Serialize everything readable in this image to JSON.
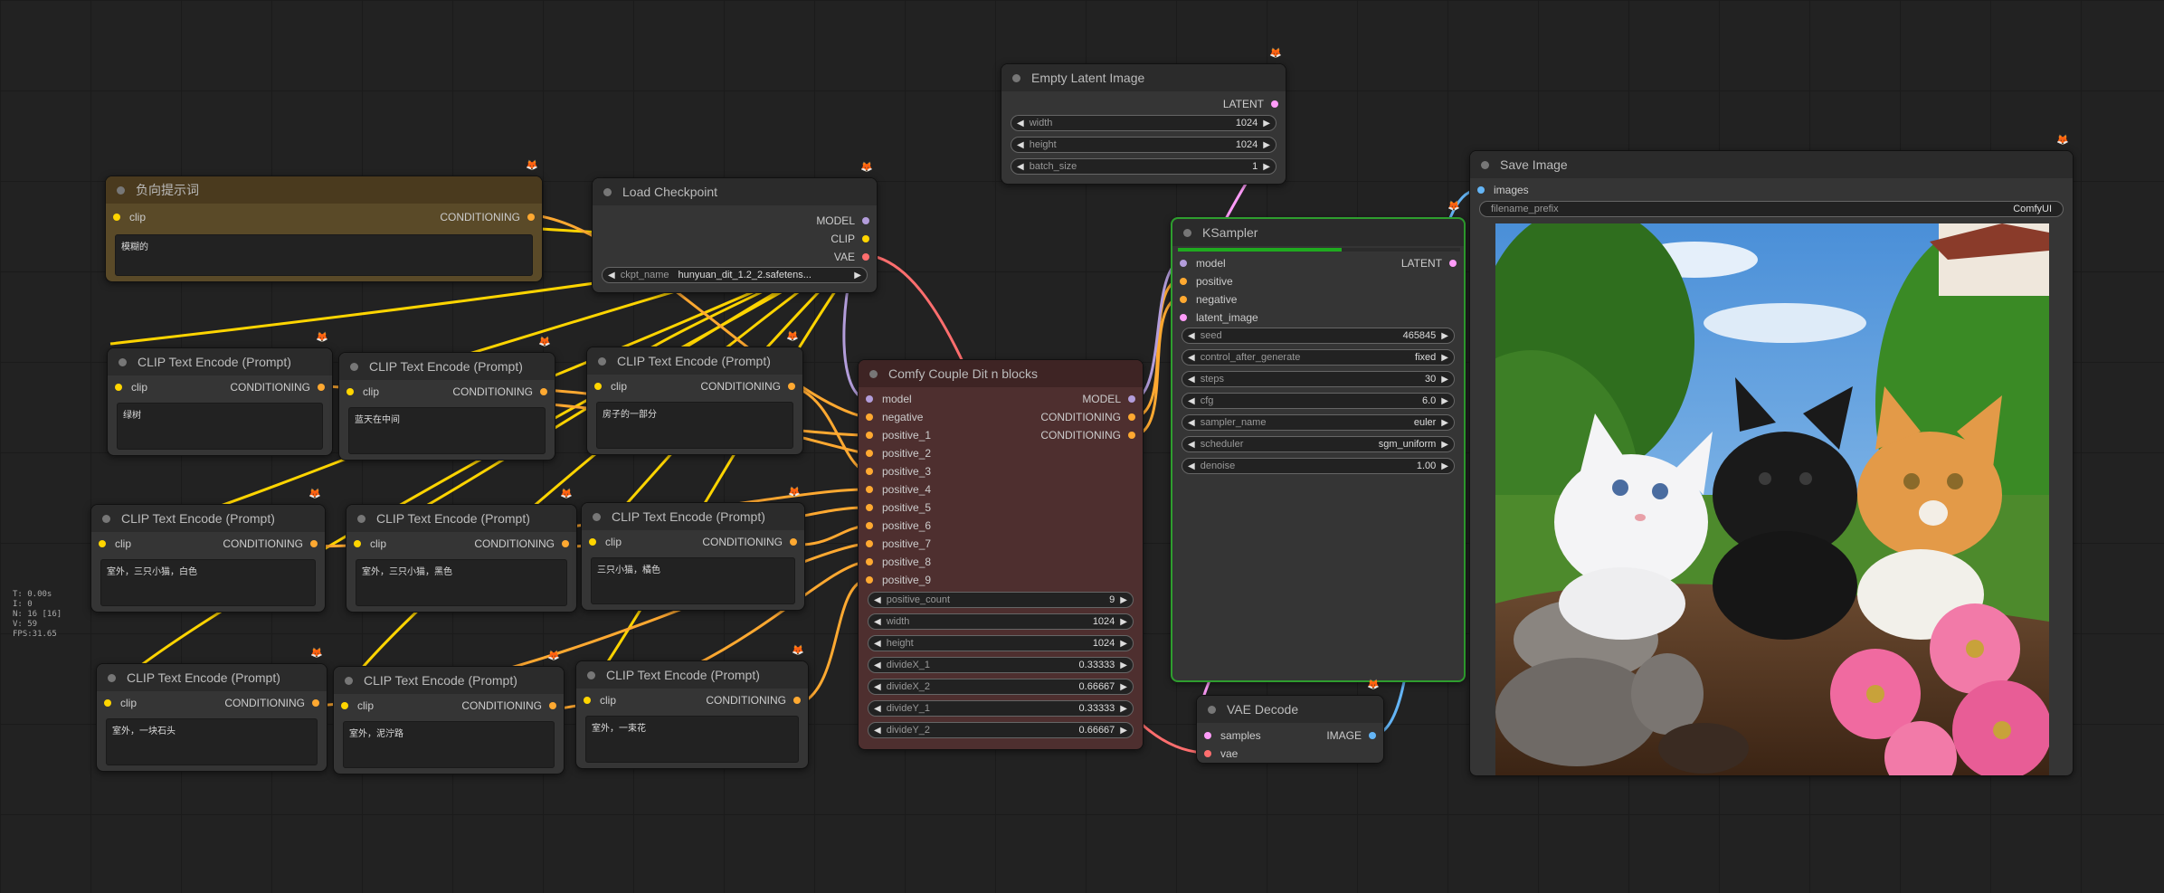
{
  "colors": {
    "clip_pin": "#ffd500",
    "conditioning_pin": "#ffa931",
    "model_pin": "#b39ddb",
    "vae_pin": "#ff6e6e",
    "latent_pin": "#ff9cf9",
    "image_pin": "#64b5f6",
    "ksampler_border": "#2e9e2e",
    "couple_bg": "#4e2f2f",
    "negative_bg": "#5a4a28"
  },
  "stats": [
    "T: 0.00s",
    "I: 0",
    "N: 16 [16]",
    "V: 59",
    "FPS:31.65"
  ],
  "negative_prompt": {
    "title": "负向提示词",
    "in_clip": "clip",
    "out": "CONDITIONING",
    "text": "模糊的"
  },
  "load_checkpoint": {
    "title": "Load Checkpoint",
    "out_model": "MODEL",
    "out_clip": "CLIP",
    "out_vae": "VAE",
    "ckpt_label": "ckpt_name",
    "ckpt_value": "hunyuan_dit_1.2_2.safetens..."
  },
  "empty_latent": {
    "title": "Empty Latent Image",
    "out": "LATENT",
    "width_label": "width",
    "width": "1024",
    "height_label": "height",
    "height": "1024",
    "batch_label": "batch_size",
    "batch": "1"
  },
  "clip_nodes": [
    {
      "title": "CLIP Text Encode (Prompt)",
      "in": "clip",
      "out": "CONDITIONING",
      "text": "绿树"
    },
    {
      "title": "CLIP Text Encode (Prompt)",
      "in": "clip",
      "out": "CONDITIONING",
      "text": "蓝天在中间"
    },
    {
      "title": "CLIP Text Encode (Prompt)",
      "in": "clip",
      "out": "CONDITIONING",
      "text": "房子的一部分"
    },
    {
      "title": "CLIP Text Encode (Prompt)",
      "in": "clip",
      "out": "CONDITIONING",
      "text": "室外，三只小猫，白色"
    },
    {
      "title": "CLIP Text Encode (Prompt)",
      "in": "clip",
      "out": "CONDITIONING",
      "text": "室外，三只小猫，黑色"
    },
    {
      "title": "CLIP Text Encode (Prompt)",
      "in": "clip",
      "out": "CONDITIONING",
      "text": "三只小猫，橘色"
    },
    {
      "title": "CLIP Text Encode (Prompt)",
      "in": "clip",
      "out": "CONDITIONING",
      "text": "室外，一块石头"
    },
    {
      "title": "CLIP Text Encode (Prompt)",
      "in": "clip",
      "out": "CONDITIONING",
      "text": "室外，泥泞路"
    },
    {
      "title": "CLIP Text Encode (Prompt)",
      "in": "clip",
      "out": "CONDITIONING",
      "text": "室外，一束花"
    }
  ],
  "couple": {
    "title": "Comfy Couple Dit n blocks",
    "inputs": [
      "model",
      "negative",
      "positive_1",
      "positive_2",
      "positive_3",
      "positive_4",
      "positive_5",
      "positive_6",
      "positive_7",
      "positive_8",
      "positive_9"
    ],
    "outputs": [
      "MODEL",
      "CONDITIONING",
      "CONDITIONING"
    ],
    "widgets": [
      {
        "label": "positive_count",
        "value": "9"
      },
      {
        "label": "width",
        "value": "1024"
      },
      {
        "label": "height",
        "value": "1024"
      },
      {
        "label": "divideX_1",
        "value": "0.33333"
      },
      {
        "label": "divideX_2",
        "value": "0.66667"
      },
      {
        "label": "divideY_1",
        "value": "0.33333"
      },
      {
        "label": "divideY_2",
        "value": "0.66667"
      }
    ]
  },
  "ksampler": {
    "title": "KSampler",
    "progress": 0.58,
    "inputs": [
      "model",
      "positive",
      "negative",
      "latent_image"
    ],
    "output": "LATENT",
    "widgets": [
      {
        "label": "seed",
        "value": "465845"
      },
      {
        "label": "control_after_generate",
        "value": "fixed"
      },
      {
        "label": "steps",
        "value": "30"
      },
      {
        "label": "cfg",
        "value": "6.0"
      },
      {
        "label": "sampler_name",
        "value": "euler"
      },
      {
        "label": "scheduler",
        "value": "sgm_uniform"
      },
      {
        "label": "denoise",
        "value": "1.00"
      }
    ]
  },
  "vae_decode": {
    "title": "VAE Decode",
    "in_samples": "samples",
    "in_vae": "vae",
    "out": "IMAGE"
  },
  "save_image": {
    "title": "Save Image",
    "in_images": "images",
    "prefix_label": "filename_prefix",
    "prefix_value": "ComfyUI",
    "image_alt": "three kittens (white, black, orange) on mud with rocks, pink flowers, green trees and blue sky"
  }
}
